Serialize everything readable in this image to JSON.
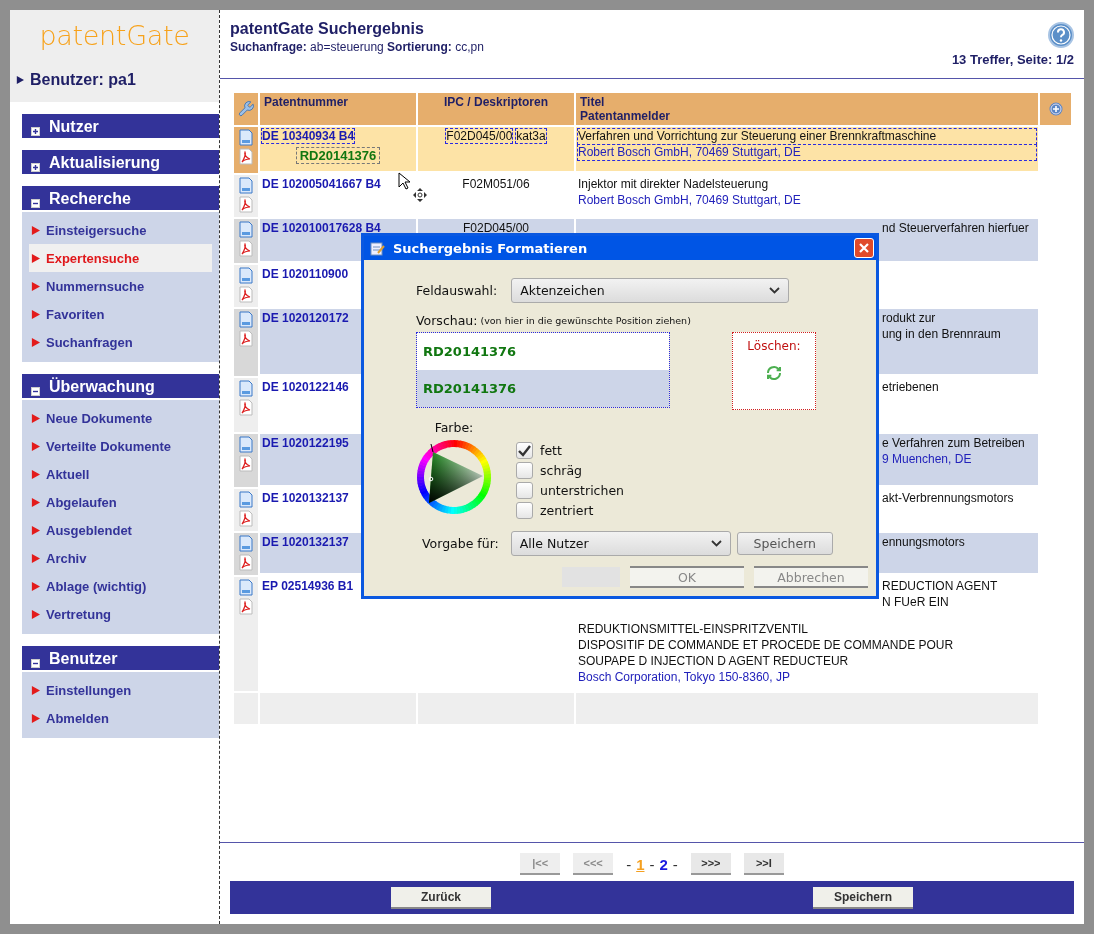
{
  "logo": {
    "text": "patentGate"
  },
  "user": {
    "label": "Benutzer: pa1"
  },
  "sidebar": {
    "sections": [
      {
        "title": "Nutzer",
        "expanded": false
      },
      {
        "title": "Aktualisierung",
        "expanded": false
      },
      {
        "title": "Recherche",
        "expanded": true,
        "items": [
          {
            "label": "Einsteigersuche",
            "selected": false
          },
          {
            "label": "Expertensuche",
            "selected": true
          },
          {
            "label": "Nummernsuche",
            "selected": false
          },
          {
            "label": "Favoriten",
            "selected": false
          },
          {
            "label": "Suchanfragen",
            "selected": false
          }
        ]
      },
      {
        "title": "Überwachung",
        "expanded": true,
        "items": [
          {
            "label": "Neue Dokumente",
            "selected": false
          },
          {
            "label": "Verteilte Dokumente",
            "selected": false
          },
          {
            "label": "Aktuell",
            "selected": false
          },
          {
            "label": "Abgelaufen",
            "selected": false
          },
          {
            "label": "Ausgeblendet",
            "selected": false
          },
          {
            "label": "Archiv",
            "selected": false
          },
          {
            "label": "Ablage (wichtig)",
            "selected": false
          },
          {
            "label": "Vertretung",
            "selected": false
          }
        ]
      },
      {
        "title": "Benutzer",
        "expanded": true,
        "items": [
          {
            "label": "Einstellungen",
            "selected": false
          },
          {
            "label": "Abmelden",
            "selected": false
          }
        ]
      }
    ]
  },
  "header": {
    "title": "patentGate Suchergebnis",
    "query_label": "Suchanfrage:",
    "query": "ab=steuerung",
    "sort_label": "Sortierung:",
    "sort": "cc,pn",
    "hits": "13 Treffer, Seite: 1/2"
  },
  "table": {
    "columns": [
      {
        "label": "Patentnummer"
      },
      {
        "label": "IPC / Deskriptoren"
      },
      {
        "label": "Titel",
        "sublabel": "Patentanmelder"
      }
    ],
    "rows": [
      {
        "selected": true,
        "number": "DE 10340934 B4",
        "tag": "RD20141376",
        "ipc": [
          "F02D045/00",
          "kat3a"
        ],
        "lines": [
          {
            "kind": "title",
            "text": "Verfahren und Vorrichtung zur Steuerung einer Brennkraftmaschine",
            "clipped": false
          },
          {
            "kind": "applicant",
            "text": "Robert Bosch GmbH, 70469 Stuttgart, DE",
            "clipped": false
          }
        ]
      },
      {
        "selected": false,
        "number": "DE 102005041667 B4",
        "ipc": [
          "F02M051/06"
        ],
        "lines": [
          {
            "kind": "title",
            "text": "Injektor mit direkter Nadelsteuerung",
            "clipped": false
          },
          {
            "kind": "applicant",
            "text": "Robert Bosch GmbH, 70469 Stuttgart, DE",
            "clipped": false
          }
        ]
      },
      {
        "selected": false,
        "number": "DE 102010017628 B4",
        "ipc": [
          "F02D045/00"
        ],
        "lines": [
          {
            "kind": "title",
            "text": "nd Steuerverfahren hierfuer",
            "clipped": true
          }
        ]
      },
      {
        "selected": false,
        "number": "DE 1020110900",
        "lines": []
      },
      {
        "selected": false,
        "number": "DE 1020120172",
        "lines": [
          {
            "kind": "title",
            "text": "rodukt zur",
            "clipped": true
          },
          {
            "kind": "title",
            "text": "ung in den Brennraum",
            "clipped": true
          }
        ]
      },
      {
        "selected": false,
        "number": "DE 1020122146",
        "lines": [
          {
            "kind": "title",
            "text": "etriebenen",
            "clipped": true
          }
        ]
      },
      {
        "selected": false,
        "number": "DE 1020122195",
        "lines": [
          {
            "kind": "title",
            "text": "e Verfahren zum Betreiben",
            "clipped": true
          },
          {
            "kind": "applicant",
            "text": "9 Muenchen, DE",
            "clipped": true
          }
        ]
      },
      {
        "selected": false,
        "number": "DE 1020132137",
        "lines": [
          {
            "kind": "title",
            "text": "akt-Verbrennungsmotors",
            "clipped": true
          }
        ]
      },
      {
        "selected": false,
        "number": "DE 1020132137",
        "lines": [
          {
            "kind": "title",
            "text": "ennungsmotors",
            "clipped": true
          }
        ]
      },
      {
        "selected": false,
        "number": "EP 02514936 B1",
        "lines": [
          {
            "kind": "title",
            "text": "REDUCTION AGENT",
            "clipped": true
          },
          {
            "kind": "title",
            "text": "N FUeR EIN",
            "clipped": true
          },
          {
            "kind": "title",
            "text": "REDUKTIONSMITTEL-EINSPRITZVENTIL",
            "clipped": false
          },
          {
            "kind": "title",
            "text": "DISPOSITIF DE COMMANDE ET PROCEDE DE COMMANDE POUR",
            "clipped": false
          },
          {
            "kind": "title",
            "text": "SOUPAPE D INJECTION D AGENT REDUCTEUR",
            "clipped": false
          },
          {
            "kind": "applicant",
            "text": "Bosch Corporation, Tokyo 150-8360, JP",
            "clipped": false
          }
        ]
      }
    ]
  },
  "pagination": {
    "first": {
      "label": "|<<",
      "disabled": true
    },
    "prev": {
      "label": "<<<",
      "disabled": true
    },
    "separator": "-",
    "pages": [
      {
        "label": "1",
        "selected": true
      },
      {
        "label": "2",
        "selected": false
      }
    ],
    "next": {
      "label": ">>>",
      "disabled": false
    },
    "last": {
      "label": ">>I",
      "disabled": false
    }
  },
  "footer_buttons": [
    "Zurück",
    "Speichern"
  ],
  "dialog": {
    "title": "Suchergebnis Formatieren",
    "field_label": "Feldauswahl:",
    "field_value": "Aktenzeichen",
    "preview_label": "Vorschau:",
    "preview_hint": "(von hier in die gewünschte Position ziehen)",
    "preview_items": [
      "RD20141376",
      "RD20141376"
    ],
    "delete_label": "Löschen:",
    "color_label": "Farbe:",
    "options": [
      {
        "label": "fett",
        "checked": true
      },
      {
        "label": "schräg",
        "checked": false
      },
      {
        "label": "unterstrichen",
        "checked": false
      },
      {
        "label": "zentriert",
        "checked": false
      }
    ],
    "preset_label": "Vorgabe für:",
    "preset_value": "Alle Nutzer",
    "save": "Speichern",
    "ok": "OK",
    "cancel": "Abbrechen"
  }
}
